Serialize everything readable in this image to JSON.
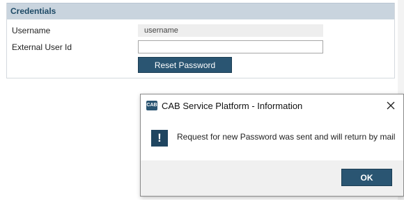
{
  "credentials": {
    "title": "Credentials",
    "username_label": "Username",
    "username_value": "username",
    "external_id_label": "External User Id",
    "external_id_value": "",
    "reset_button": "Reset Password"
  },
  "dialog": {
    "app_icon_text": "CAB",
    "title": "CAB Service Platform - Information",
    "message": "Request for new Password was sent and will return by mail",
    "ok_label": "OK"
  },
  "icons": {
    "app": "cab-app-icon",
    "close": "close-icon",
    "info": "exclamation-icon"
  },
  "colors": {
    "accent": "#2a5572",
    "header_bg": "#c9d4de",
    "header_text": "#1e4a66"
  }
}
